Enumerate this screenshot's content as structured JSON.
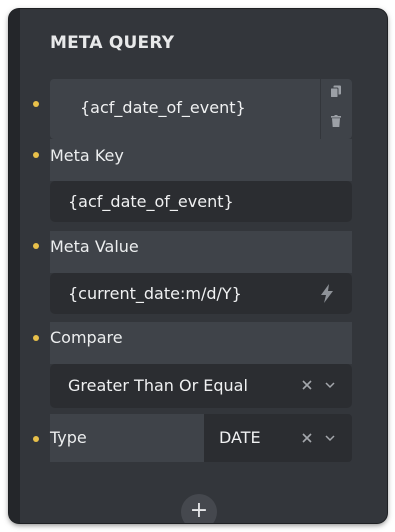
{
  "panel": {
    "title": "META QUERY"
  },
  "repeater_item": {
    "label": "{acf_date_of_event}",
    "icons": [
      "copy-icon",
      "trash-icon"
    ]
  },
  "fields": {
    "meta_key": {
      "label": "Meta Key",
      "value": "{acf_date_of_event}"
    },
    "meta_value": {
      "label": "Meta Value",
      "value": "{current_date:m/d/Y}",
      "icon": "lightning-icon"
    },
    "compare": {
      "label": "Compare",
      "value": "Greater Than Or Equal",
      "icons": [
        "clear-icon",
        "chevron-down-icon"
      ]
    },
    "type": {
      "label": "Type",
      "value": "DATE",
      "icons": [
        "clear-icon",
        "chevron-down-icon"
      ]
    }
  },
  "add_button": {
    "label": "+"
  },
  "colors": {
    "panel_bg": "#33363b",
    "row_bg": "#3f4349",
    "input_bg": "#2b2d31",
    "bullet": "#e8c04a",
    "text": "#f0f1f2"
  }
}
